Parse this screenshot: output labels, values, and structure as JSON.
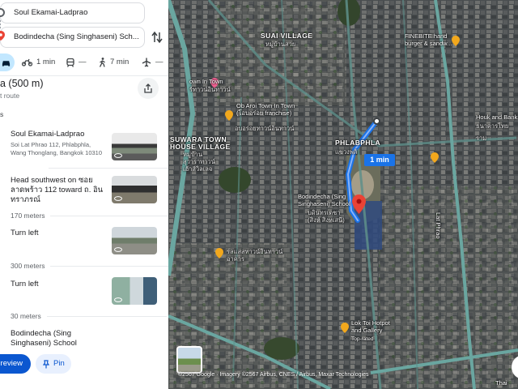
{
  "directions": {
    "origin": "Soul Ekamai-Ladprao",
    "destination": "Bodindecha (Sing Singhaseni) Sch...",
    "modes": [
      {
        "id": "drive",
        "label": "",
        "icon": "car-icon",
        "selected": true
      },
      {
        "id": "motorcycle",
        "label": "1 min",
        "icon": "motorcycle-icon"
      },
      {
        "id": "transit",
        "label": "—",
        "icon": "transit-icon"
      },
      {
        "id": "walk",
        "label": "7 min",
        "icon": "walk-icon"
      },
      {
        "id": "flight",
        "label": "—",
        "icon": "flight-icon"
      }
    ],
    "summary": {
      "distance": "a (500 m)",
      "sub": "t route"
    },
    "section_label": "s",
    "steps": [
      {
        "title": "Soul Ekamai-Ladprao",
        "sub": "Soi Lat Phrao 112, Phlabphla, Wang Thonglang, Bangkok 10310"
      },
      {
        "title": "Head southwest on ซอยลาดพร้าว 112 toward ถ. อินทราภรณ์",
        "sub": "",
        "distance_after": "170 meters"
      },
      {
        "title": "Turn left",
        "sub": "",
        "distance_after": "300 meters"
      },
      {
        "title": "Turn left",
        "sub": "",
        "distance_after": "30 meters"
      },
      {
        "title": "Bodindecha (Sing Singhaseni) School",
        "sub": ""
      }
    ],
    "buttons": {
      "preview": "Preview",
      "pin": "Pin"
    }
  },
  "map": {
    "labels": {
      "suai_village": "SUAI VILLAGE",
      "suai_village_th": "หมู่บ้านสวย",
      "finebite": "FINEBITE hand\nburger & sandw...",
      "town_in_town": "own In Town",
      "town_in_town_th": "ร์ทาวน์อินทาวน์",
      "ob_aroi": "Ob Aroi Town In Town\n(โอบอร่อย franchise)",
      "ob_aroi_th": "อบอร่อยทาวน์อินทาวน์",
      "suwara": "SUWARA TOWN\nHOUSE VILLAGE",
      "suwara_th": "หมู่บ้าน\nสุวาราทาวน์\nเฮ้าส์วิลเลจ",
      "phlabphla": "PHLABPHLA",
      "phlabphla_th": "แขวงพลั",
      "eta": "1 min",
      "school": "Bodindecha (Sing\nSinghaseni) School",
      "school_th": "บดินทรเดชา\n(สิงห์ สิงหเสนี)",
      "huok": "Houk and Bank",
      "huok_th": "ธนาคารไทย",
      "lat_phrao": "ราม",
      "town_in_town_tail": "รลแสสทาวน์อินทาวน์\nอาคาร",
      "lok_toi": "Lok Toi Hotpot\nand Gallery",
      "lok_toi_sub": "Top-rated",
      "thai": "Thai",
      "street_v": "Lat Phrao"
    },
    "attribution": "©2567 Google · Imagery ©2567 Airbus, CNES / Airbus, Maxar Technologies",
    "colors": {
      "route": "#1a73e8",
      "road": "#6aa6a0",
      "accent": "#0b57d0",
      "poi": "#f2a81d",
      "pink": "#f06292",
      "pin": "#ea4335"
    }
  }
}
